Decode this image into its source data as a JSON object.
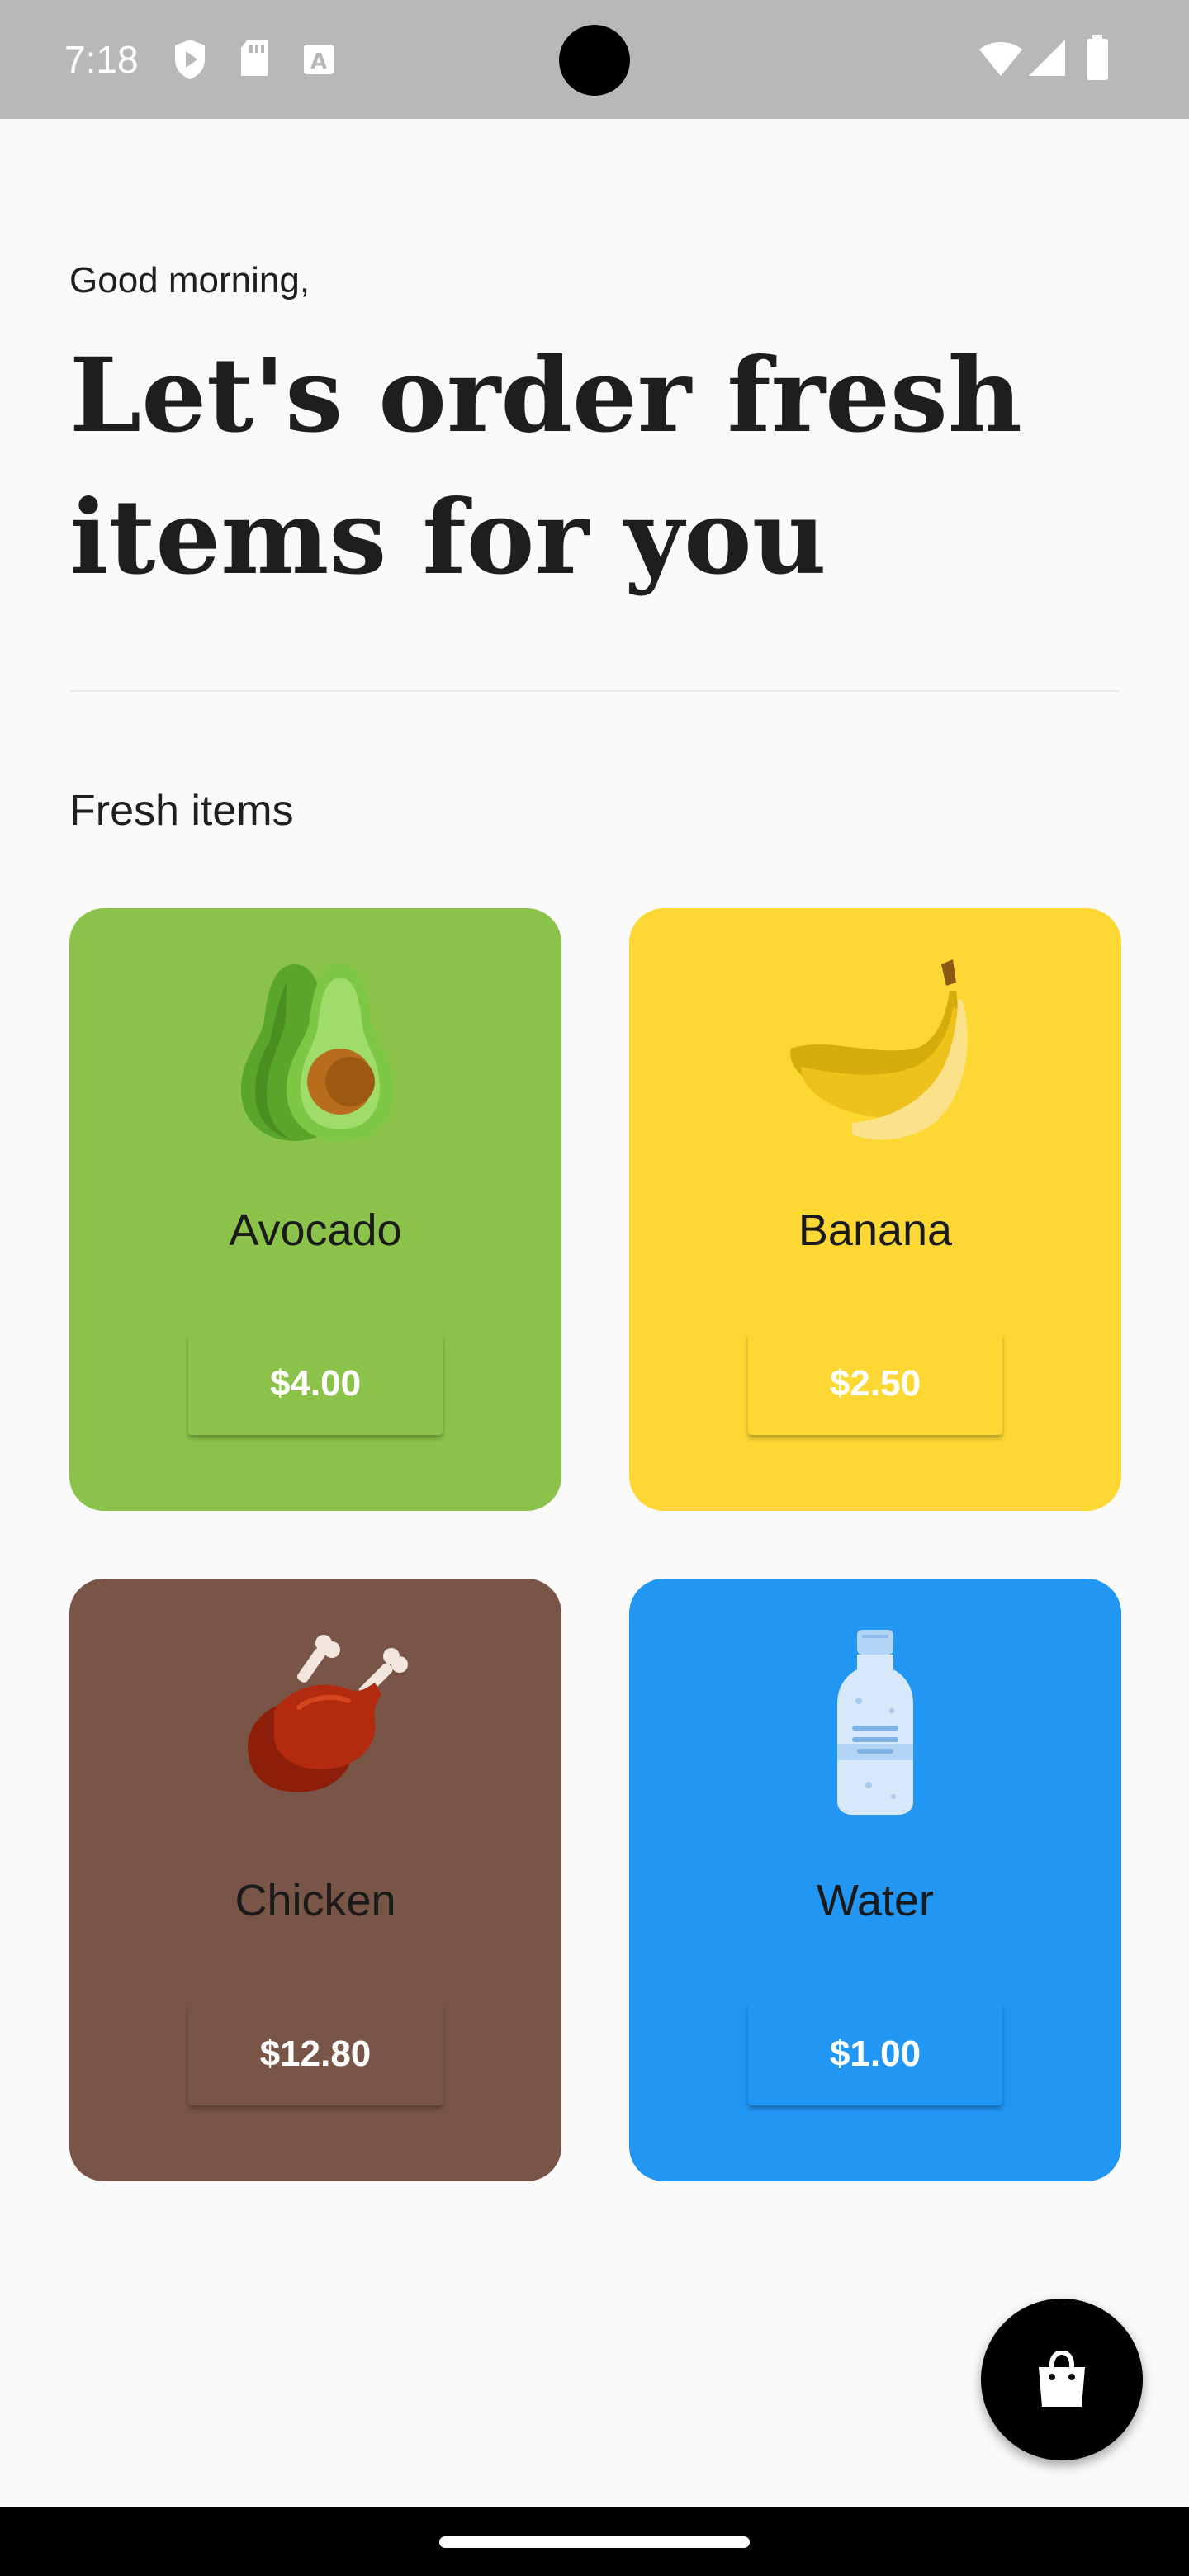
{
  "status_bar": {
    "time": "7:18",
    "icons": [
      "shield-play-icon",
      "sd-card-icon",
      "font-a-icon",
      "wifi-icon",
      "cellular-icon",
      "battery-icon"
    ]
  },
  "header": {
    "greeting": "Good morning,",
    "headline": "Let's order fresh items for you"
  },
  "section": {
    "title": "Fresh items"
  },
  "products": [
    {
      "name": "Avocado",
      "price": "$4.00",
      "color": "#8BC34A",
      "button_color": "#8BC34A",
      "icon": "avocado-icon"
    },
    {
      "name": "Banana",
      "price": "$2.50",
      "color": "#FDD835",
      "button_color": "#FDD835",
      "icon": "banana-icon"
    },
    {
      "name": "Chicken",
      "price": "$12.80",
      "color": "#795548",
      "button_color": "#795548",
      "icon": "chicken-icon"
    },
    {
      "name": "Water",
      "price": "$1.00",
      "color": "#2196F3",
      "button_color": "#2196F3",
      "icon": "water-bottle-icon"
    }
  ],
  "cart_button": {
    "icon": "shopping-bag-icon"
  },
  "colors": {
    "background": "#FAFAFA",
    "status_bar": "#B8B8B8",
    "fab": "#000000"
  }
}
